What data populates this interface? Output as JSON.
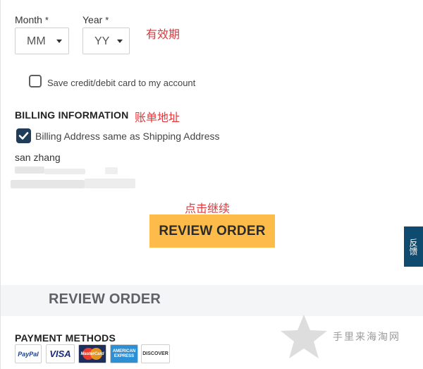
{
  "expiry": {
    "month_label": "Month",
    "year_label": "Year",
    "required_mark": "*",
    "month_value": "MM",
    "year_value": "YY",
    "annotation": "有效期"
  },
  "save_card": {
    "label": "Save credit/debit card to my account",
    "checked": false
  },
  "billing": {
    "heading": "BILLING INFORMATION",
    "annotation": "账单地址",
    "same_as_shipping_label": "Billing Address same as Shipping Address",
    "same_as_shipping_checked": true,
    "name": "san zhang"
  },
  "continue": {
    "annotation": "点击继续",
    "button_label": "REVIEW ORDER"
  },
  "feedback_tab": {
    "label": "反馈"
  },
  "review_section": {
    "title": "REVIEW ORDER"
  },
  "payment": {
    "heading": "PAYMENT METHODS",
    "logos": [
      {
        "icon": "paypal-logo",
        "text": "PayPal"
      },
      {
        "icon": "visa-logo",
        "text": "VISA"
      },
      {
        "icon": "mastercard-logo",
        "text": "MasterCard"
      },
      {
        "icon": "amex-logo",
        "text": "AMERICAN EXPRESS"
      },
      {
        "icon": "discover-logo",
        "text": "DISCOVER"
      }
    ]
  },
  "watermark": {
    "text": "手里来海淘网"
  },
  "colors": {
    "primary_button": "#fdbb4a",
    "annotation": "#e0373b",
    "feedback_tab": "#0e4b6e",
    "checkbox_checked": "#1f3d59",
    "band": "#f3f5f7"
  }
}
